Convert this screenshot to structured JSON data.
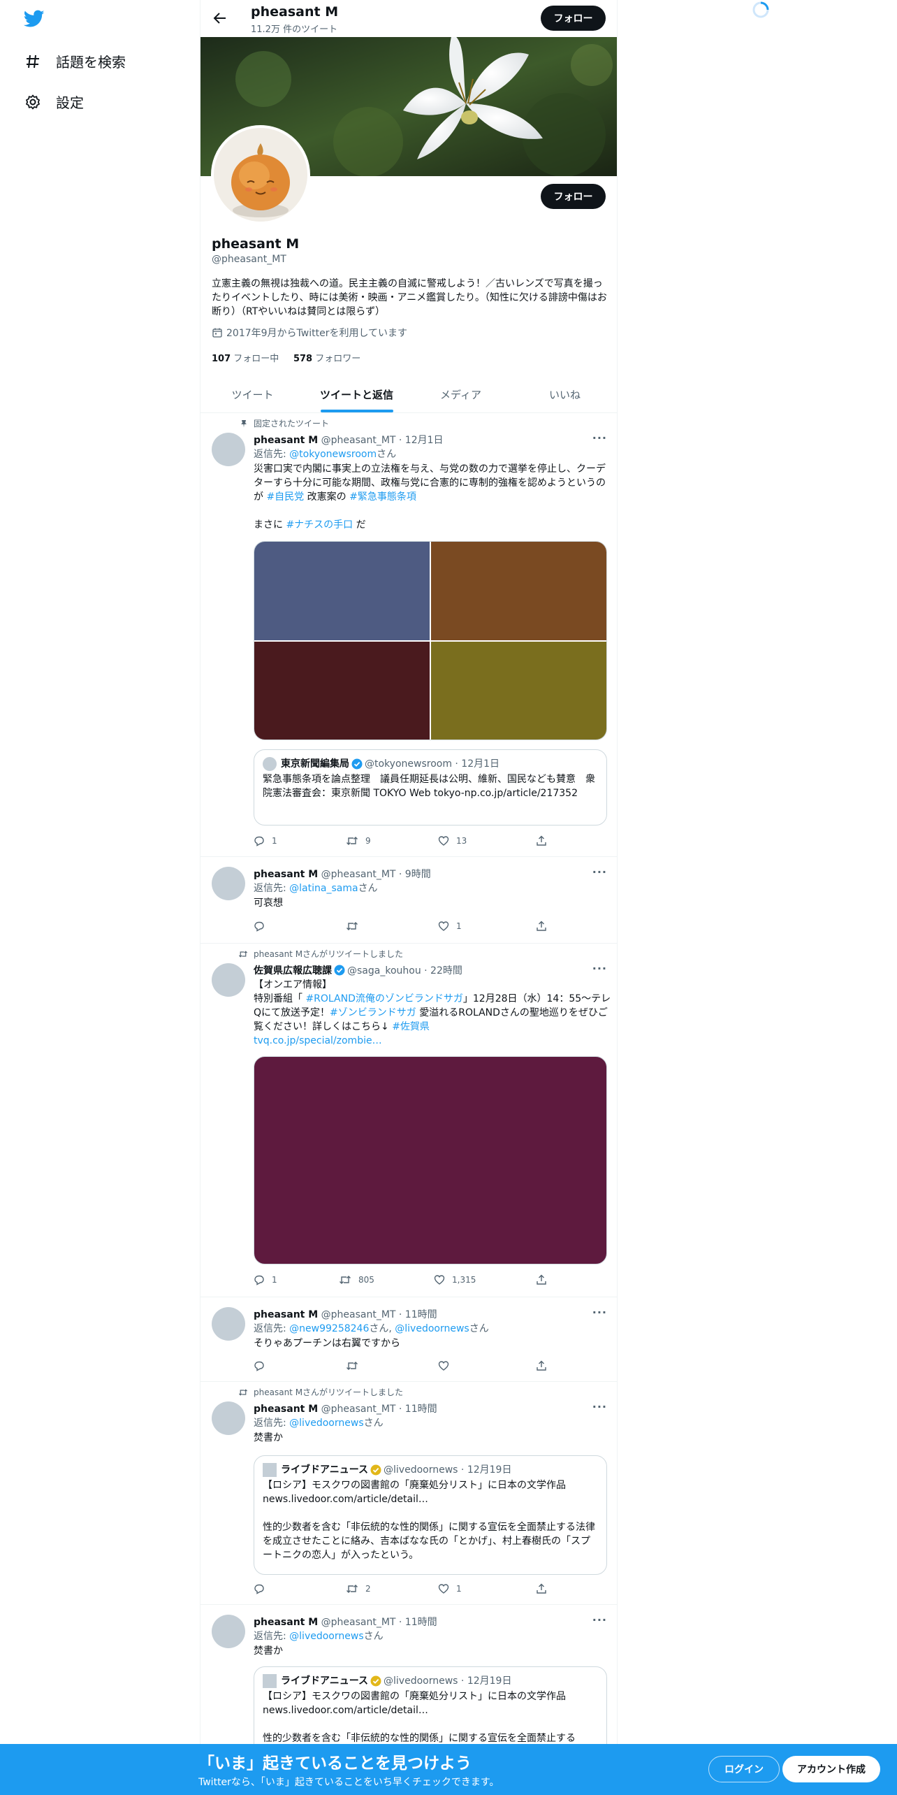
{
  "sidebar": {
    "logo": "twitter-bird-icon",
    "items": [
      {
        "icon": "hashtag-icon",
        "label": "話題を検索"
      },
      {
        "icon": "gear-icon",
        "label": "設定"
      }
    ]
  },
  "header": {
    "name": "pheasant M",
    "tweet_count": "11.2万 件のツイート",
    "follow_label": "フォロー"
  },
  "profile": {
    "name": "pheasant M",
    "handle": "@pheasant_MT",
    "bio": "立憲主義の無視は独裁への道。民主主義の自滅に警戒しよう！／古いレンズで写真を撮ったりイベントしたり、時には美術・映画・アニメ鑑賞したり。（知性に欠ける誹謗中傷はお断り）（RTやいいねは賛同とは限らず）",
    "joined": "2017年9月からTwitterを利用しています",
    "following_count": "107",
    "following_label": "フォロー中",
    "followers_count": "578",
    "followers_label": "フォロワー",
    "follow_label": "フォロー"
  },
  "tabs": [
    "ツイート",
    "ツイートと返信",
    "メディア",
    "いいね"
  ],
  "tweets": {
    "t1": {
      "social": "固定されたツイート",
      "name": "pheasant M",
      "meta": "@pheasant_MT · 12月1日",
      "reply_prefix": "返信先: ",
      "reply_user": "@tokyonewsroom",
      "reply_suffix": "さん",
      "text1": "災害口実で内閣に事実上の立法権を与え、与党の数の力で選挙を停止し、クーデターすら十分に可能な期間、政権与党に合憲的に専制的強権を認めようというのが ",
      "tag1": "#自民党",
      "text2": " 改憲案の ",
      "tag2": "#緊急事態条項",
      "text3": "まさに ",
      "tag3": "#ナチスの手口",
      "text4": " だ",
      "image_colors": [
        "#4e5b82",
        "#7a4a22",
        "#4a1a1e",
        "#7a6e1e"
      ],
      "quote": {
        "name": "東京新聞編集局",
        "meta": "@tokyonewsroom · 12月1日",
        "text": "緊急事態条項を論点整理　議員任期延長は公明、維新、国民なども賛意　衆院憲法審査会：東京新聞 TOKYO Web tokyo-np.co.jp/article/217352"
      },
      "replies": "1",
      "retweets": "9",
      "likes": "13"
    },
    "t2": {
      "name": "pheasant M",
      "meta": "@pheasant_MT · 9時間",
      "reply_prefix": "返信先: ",
      "reply_user": "@latina_sama",
      "reply_suffix": "さん",
      "text": "可哀想",
      "replies": "",
      "retweets": "",
      "likes": "1"
    },
    "t3": {
      "social": "pheasant Mさんがリツイートしました",
      "name": "佐賀県広報広聴課",
      "meta": "@saga_kouhou · 22時間",
      "line1": "【オンエア情報】",
      "text1": "特別番組「 ",
      "tag1": "#ROLAND流俺のゾンビランドサガ",
      "text2": "」12月28日（水）14：55～テレQにて放送予定！",
      "tag2": "#ゾンビランドサガ",
      "text3": " 愛溢れるROLANDさんの聖地巡りをぜひご覧ください！詳しくはこちら↓ ",
      "tag3": "#佐賀県",
      "link": "tvq.co.jp/special/zombie…",
      "image_color": "#5e1a3e",
      "replies": "1",
      "retweets": "805",
      "likes": "1,315"
    },
    "t4": {
      "name": "pheasant M",
      "meta": "@pheasant_MT · 11時間",
      "reply_prefix": "返信先: ",
      "reply_user1": "@new99258246",
      "reply_mid": "さん, ",
      "reply_user2": "@livedoornews",
      "reply_suffix": "さん",
      "text": "そりゃあプーチンは右翼ですから",
      "replies": "",
      "retweets": "",
      "likes": ""
    },
    "t5": {
      "social": "pheasant Mさんがリツイートしました",
      "name": "pheasant M",
      "meta": "@pheasant_MT · 11時間",
      "reply_prefix": "返信先: ",
      "reply_user": "@livedoornews",
      "reply_suffix": "さん",
      "text": "焚書か",
      "quote": {
        "name": "ライブドアニュース",
        "meta": "@livedoornews · 12月19日",
        "text1": "【ロシア】モスクワの図書館の「廃棄処分リスト」に日本の文学作品",
        "link": "news.livedoor.com/article/detail…",
        "text2": "性的少数者を含む「非伝統的な性的関係」に関する宣伝を全面禁止する法律を成立させたことに絡み、吉本ばなな氏の「とかげ」、村上春樹氏の「スプートニクの恋人」が入ったという。"
      },
      "replies": "",
      "retweets": "2",
      "likes": "1"
    },
    "t6": {
      "name": "pheasant M",
      "meta": "@pheasant_MT · 11時間",
      "reply_prefix": "返信先: ",
      "reply_user": "@livedoornews",
      "reply_suffix": "さん",
      "text": "焚書か",
      "quote": {
        "name": "ライブドアニュース",
        "meta": "@livedoornews · 12月19日",
        "text1": "【ロシア】モスクワの図書館の「廃棄処分リスト」に日本の文学作品",
        "link": "news.livedoor.com/article/detail…",
        "text2": "性的少数者を含む「非伝統的な性的関係」に関する宣伝を全面禁止する"
      }
    }
  },
  "bottom_bar": {
    "title": "「いま」起きていることを見つけよう",
    "subtitle": "Twitterなら、「いま」起きていることをいち早くチェックできます。",
    "login": "ログイン",
    "signup": "アカウント作成"
  },
  "colors": {
    "accent": "#1d9bf0",
    "button_dark": "#0f1419",
    "verified_gold": "#e2b719"
  }
}
